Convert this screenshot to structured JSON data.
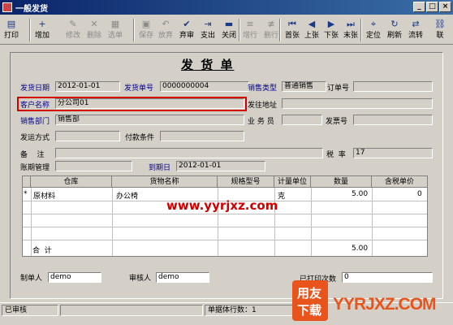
{
  "window": {
    "title": "一般发货"
  },
  "toolbar": [
    {
      "label": "打印",
      "icon": "printer-icon",
      "disabled": false
    },
    {
      "label": "增加",
      "icon": "add-icon",
      "disabled": false
    },
    {
      "label": "修改",
      "icon": "edit-icon",
      "disabled": true
    },
    {
      "label": "删除",
      "icon": "delete-icon",
      "disabled": true
    },
    {
      "label": "选单",
      "icon": "select-doc-icon",
      "disabled": true
    },
    {
      "label": "保存",
      "icon": "save-icon",
      "disabled": true
    },
    {
      "label": "放弃",
      "icon": "undo-icon",
      "disabled": true
    },
    {
      "label": "弃审",
      "icon": "unapprove-icon",
      "disabled": false
    },
    {
      "label": "支出",
      "icon": "expense-icon",
      "disabled": false
    },
    {
      "label": "关闭",
      "icon": "close-doc-icon",
      "disabled": false
    },
    {
      "label": "增行",
      "icon": "add-row-icon",
      "disabled": true
    },
    {
      "label": "删行",
      "icon": "delete-row-icon",
      "disabled": true
    },
    {
      "label": "首张",
      "icon": "first-icon",
      "disabled": false
    },
    {
      "label": "上张",
      "icon": "prev-icon",
      "disabled": false
    },
    {
      "label": "下张",
      "icon": "next-icon",
      "disabled": false
    },
    {
      "label": "末张",
      "icon": "last-icon",
      "disabled": false
    },
    {
      "label": "定位",
      "icon": "locate-icon",
      "disabled": false
    },
    {
      "label": "刷新",
      "icon": "refresh-icon",
      "disabled": false
    },
    {
      "label": "流转",
      "icon": "flow-icon",
      "disabled": false
    },
    {
      "label": "联",
      "icon": "link-icon",
      "disabled": false
    }
  ],
  "form": {
    "title": "发 货 单",
    "ship_date_label": "发货日期",
    "ship_date": "2012-01-01",
    "ship_no_label": "发货单号",
    "ship_no": "0000000004",
    "sales_type_label": "销售类型",
    "sales_type": "普通销售",
    "order_no_label": "订单号",
    "order_no": "",
    "customer_label": "客户名称",
    "customer": "分公司01",
    "ship_addr_label": "发往地址",
    "ship_addr": "",
    "dept_label": "销售部门",
    "dept": "销售部",
    "salesman_label": "业 务 员",
    "salesman": "",
    "invoice_label": "发票号",
    "invoice": "",
    "ship_method_label": "发运方式",
    "ship_method": "",
    "payment_label": "付款条件",
    "payment": "",
    "remark_label": "备    注",
    "remark": "",
    "tax_label": "税  率",
    "tax": "17",
    "period_label": "账期管理",
    "period": "",
    "due_label": "到期日",
    "due": "2012-01-01"
  },
  "grid": {
    "columns": [
      "仓库",
      "货物名称",
      "规格型号",
      "计量单位",
      "数量",
      "含税单价"
    ],
    "rows": [
      {
        "marker": "*",
        "warehouse": "原材料",
        "goods": "办公椅",
        "spec": "",
        "unit": "克",
        "qty": "5.00",
        "price": "0"
      }
    ],
    "total_label": "合  计",
    "total_qty": "5.00"
  },
  "footer": {
    "maker_label": "制单人",
    "maker": "demo",
    "reviewer_label": "审核人",
    "reviewer": "demo",
    "printed_label": "已打印次数",
    "printed": "0"
  },
  "status": {
    "left": "已审核",
    "rows": "单据体行数：1"
  },
  "watermark": {
    "url": "www.yyrjxz.com",
    "logo_a": "用友",
    "logo_b": "下载",
    "logo_c": "YYRJXZ.COM"
  }
}
